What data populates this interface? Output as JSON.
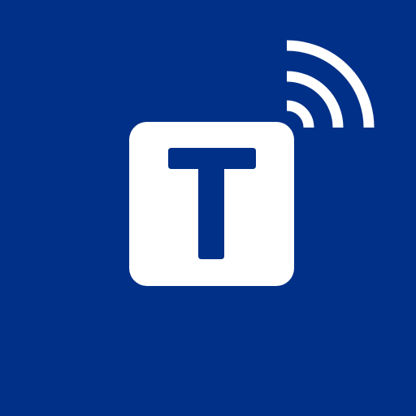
{
  "app_icon": {
    "glyph_letter": "T",
    "icon_names": {
      "tile": "rounded-square-tile",
      "letter": "letter-t-icon",
      "signal": "wireless-signal-icon"
    },
    "colors": {
      "background": "#003087",
      "tile": "#ffffff",
      "letter": "#003087",
      "signal": "#ffffff"
    }
  }
}
